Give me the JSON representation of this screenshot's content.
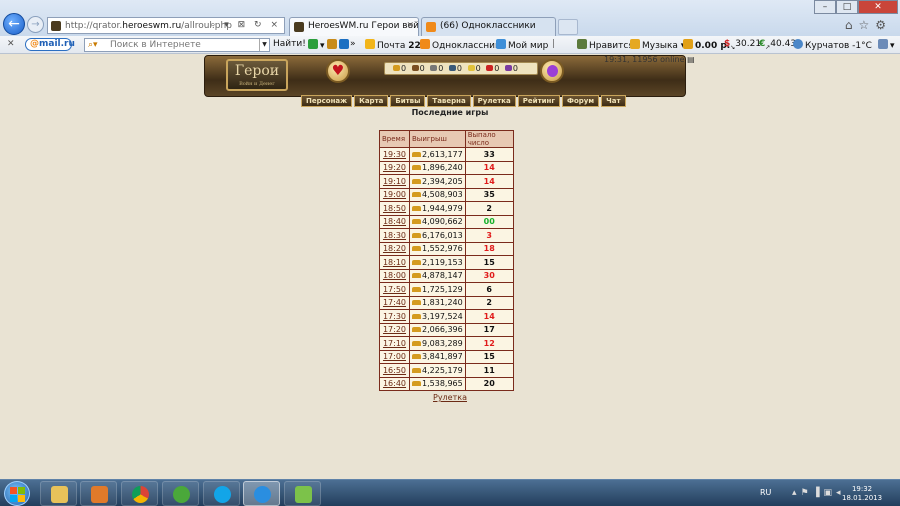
{
  "browser": {
    "url_prefix": "http://qrator.",
    "url_host": "heroeswm.ru",
    "url_path": "/allroul.php",
    "url_tools": "⌕ ▾ ⊠ ↻ ×",
    "tabs": [
      {
        "label": "HeroesWM.ru Герои войн...",
        "active": true
      },
      {
        "label": "(66) Одноклассники",
        "active": false
      }
    ],
    "window_controls": {
      "minimize": "–",
      "maximize": "□",
      "close": "✕"
    },
    "right_tools": "⌂☆⚙"
  },
  "toolbar": {
    "close": "✕",
    "mailru_at": "@",
    "mailru_label": "mail.ru",
    "search_icon": "⌕▾",
    "search_placeholder": "Поиск в Интернете",
    "find_label": "Найти!",
    "more": "»",
    "mail_label": "Почта",
    "mail_count": "227",
    "ok_label": "Одноклассники",
    "mymir_label": "Мой мир",
    "like_label": "Нравится",
    "music_label": "Музыка",
    "money": "0.00 р.",
    "usd": "30.21",
    "eur": "40.43",
    "weather": "Курчатов -1°C"
  },
  "site": {
    "logo_title": "Герои",
    "logo_sub": "Войн и Денег",
    "online": "19:31, 11956 online",
    "resources": [
      "0",
      "0",
      "0",
      "0",
      "0",
      "0",
      "0"
    ],
    "nav": [
      "Персонаж",
      "Карта",
      "Битвы",
      "Таверна",
      "Рулетка",
      "Рейтинг",
      "Форум",
      "Чат"
    ],
    "page_title": "Последние игры",
    "table": {
      "headers": [
        "Время",
        "Выигрыш",
        "Выпало число"
      ],
      "rows": [
        {
          "time": "19:30",
          "win": "2,613,177",
          "num": "33",
          "color": "black"
        },
        {
          "time": "19:20",
          "win": "1,896,240",
          "num": "14",
          "color": "red"
        },
        {
          "time": "19:10",
          "win": "2,394,205",
          "num": "14",
          "color": "red"
        },
        {
          "time": "19:00",
          "win": "4,508,903",
          "num": "35",
          "color": "black"
        },
        {
          "time": "18:50",
          "win": "1,944,979",
          "num": "2",
          "color": "black"
        },
        {
          "time": "18:40",
          "win": "4,090,662",
          "num": "00",
          "color": "green"
        },
        {
          "time": "18:30",
          "win": "6,176,013",
          "num": "3",
          "color": "red"
        },
        {
          "time": "18:20",
          "win": "1,552,976",
          "num": "18",
          "color": "red"
        },
        {
          "time": "18:10",
          "win": "2,119,153",
          "num": "15",
          "color": "black"
        },
        {
          "time": "18:00",
          "win": "4,878,147",
          "num": "30",
          "color": "red"
        },
        {
          "time": "17:50",
          "win": "1,725,129",
          "num": "6",
          "color": "black"
        },
        {
          "time": "17:40",
          "win": "1,831,240",
          "num": "2",
          "color": "black"
        },
        {
          "time": "17:30",
          "win": "3,197,524",
          "num": "14",
          "color": "red"
        },
        {
          "time": "17:20",
          "win": "2,066,396",
          "num": "17",
          "color": "black"
        },
        {
          "time": "17:10",
          "win": "9,083,289",
          "num": "12",
          "color": "red"
        },
        {
          "time": "17:00",
          "win": "3,841,897",
          "num": "15",
          "color": "black"
        },
        {
          "time": "16:50",
          "win": "4,225,179",
          "num": "11",
          "color": "black"
        },
        {
          "time": "16:40",
          "win": "1,538,965",
          "num": "20",
          "color": "black"
        }
      ]
    },
    "roulette_link": "Рулетка"
  },
  "taskbar": {
    "lang": "RU",
    "tray": "▴⚑▐▣◂",
    "time": "19:32",
    "date": "18.01.2013",
    "apps": [
      "explorer",
      "media-player",
      "chrome",
      "utorrent",
      "skype",
      "internet-explorer",
      "app-green"
    ]
  },
  "colors": {
    "cell_border": "#7a2b1c",
    "header_bg": "#e7c9b3",
    "red": "#e01b1b",
    "green": "#17b12c"
  }
}
